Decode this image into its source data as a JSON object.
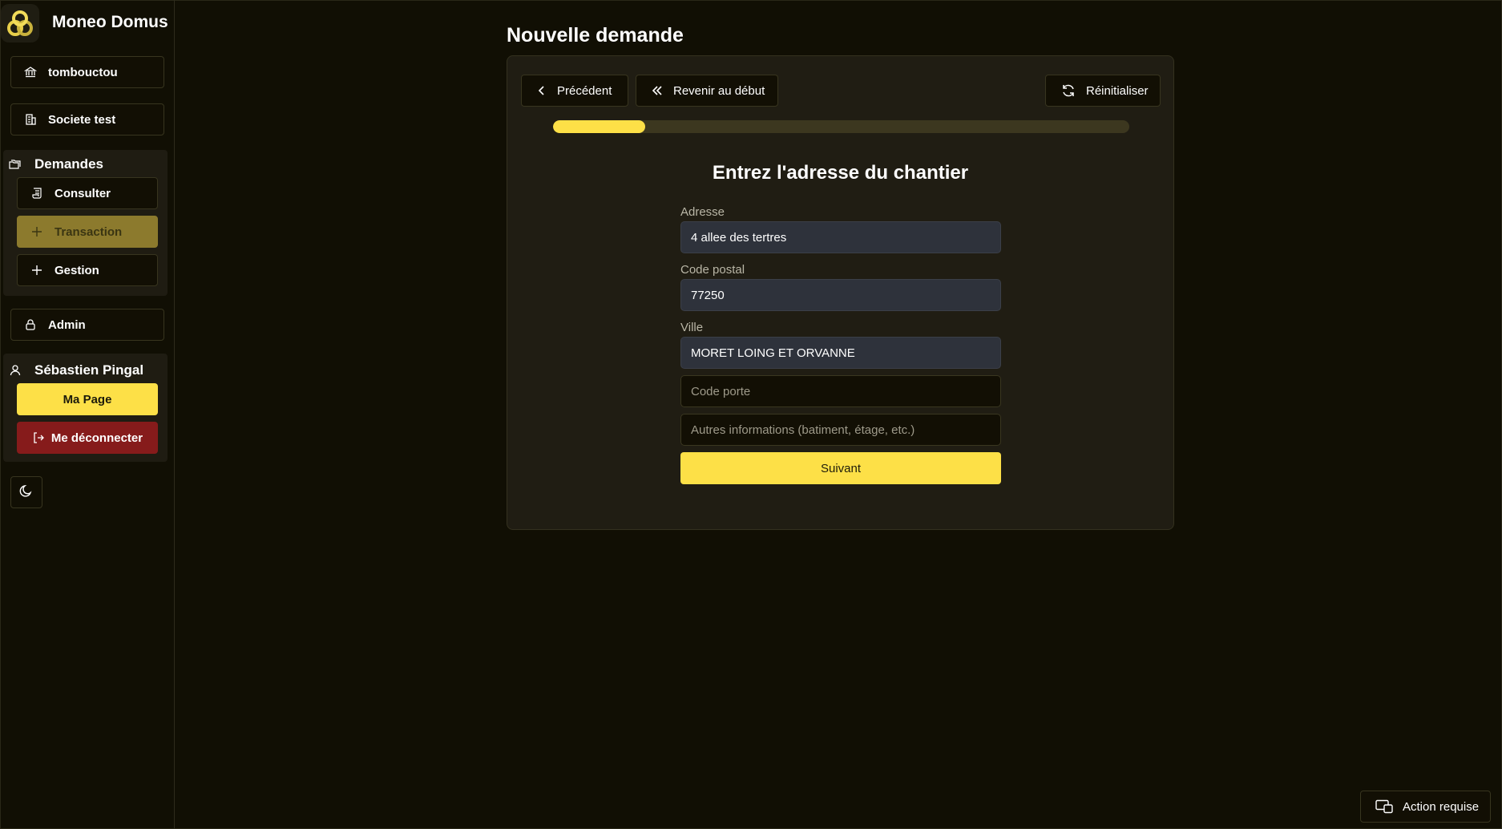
{
  "app": {
    "name": "Moneo Domus"
  },
  "sidebar": {
    "org": {
      "label": "tombouctou",
      "icon": "bank-icon"
    },
    "company": {
      "label": "Societe test",
      "icon": "building-icon"
    },
    "demandes": {
      "title": "Demandes",
      "icon": "folders-icon",
      "items": [
        {
          "label": "Consulter",
          "icon": "scroll-icon"
        },
        {
          "label": "Transaction",
          "icon": "plus-icon",
          "active": true
        },
        {
          "label": "Gestion",
          "icon": "plus-icon"
        }
      ]
    },
    "admin": {
      "label": "Admin",
      "icon": "lock-icon"
    },
    "user": {
      "name": "Sébastien Pingal",
      "icon": "user-icon",
      "my_page": "Ma Page",
      "logout": "Me déconnecter",
      "logout_icon": "logout-icon"
    },
    "theme_icon": "moon-icon"
  },
  "main": {
    "title": "Nouvelle demande",
    "nav": {
      "previous": "Précédent",
      "restart": "Revenir au début",
      "reset": "Réinitialiser"
    },
    "progress": 0.16,
    "step_title": "Entrez l'adresse du chantier",
    "form": {
      "address_label": "Adresse",
      "address_value": "4 allee des tertres",
      "postal_label": "Code postal",
      "postal_value": "77250",
      "city_label": "Ville",
      "city_value": "MORET LOING ET ORVANNE",
      "door_code_placeholder": "Code porte",
      "other_info_placeholder": "Autres informations (batiment, étage, etc.)",
      "next": "Suivant"
    }
  },
  "footer": {
    "action_required": "Action requise"
  },
  "colors": {
    "accent": "#fde047",
    "danger": "#861b1b",
    "background": "#110f04"
  }
}
